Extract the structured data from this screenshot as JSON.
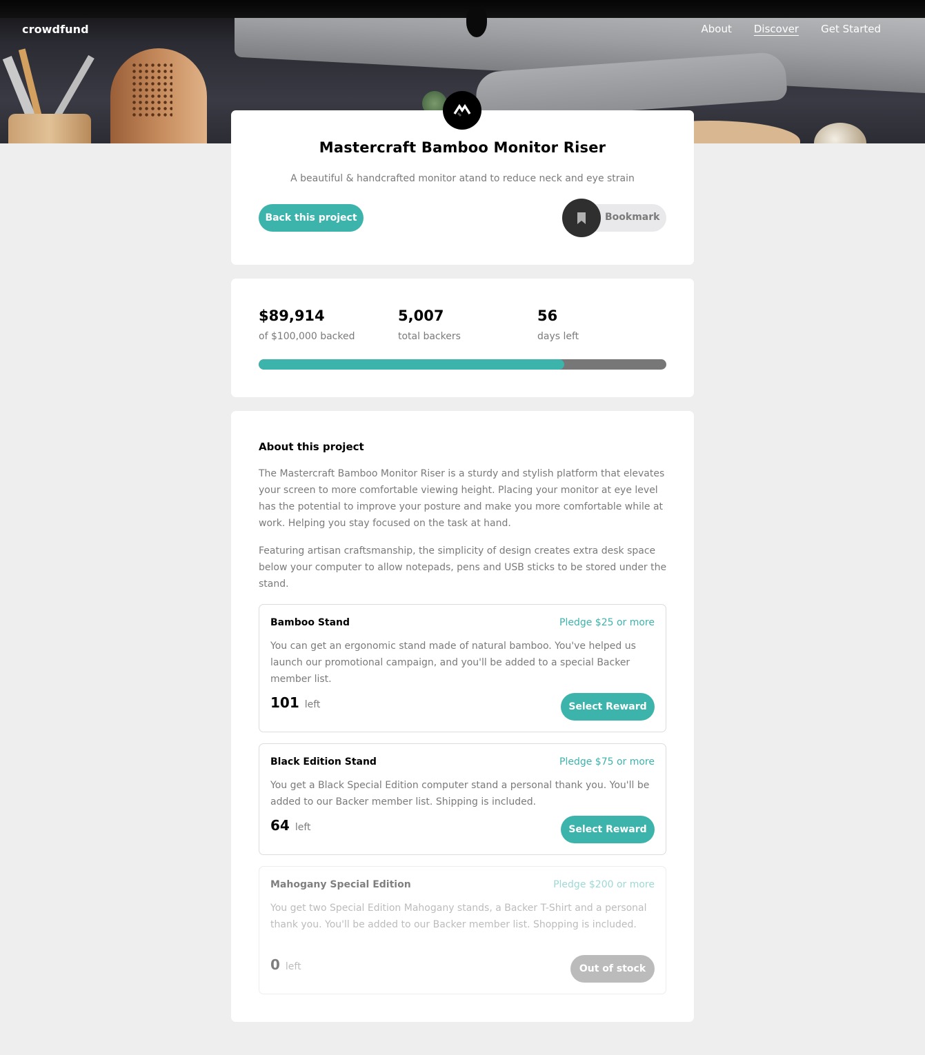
{
  "nav": {
    "logo": "crowdfund",
    "links": [
      "About",
      "Discover",
      "Get Started"
    ],
    "active": "Discover"
  },
  "project": {
    "title": "Mastercraft Bamboo Monitor Riser",
    "subtitle": "A beautiful & handcrafted monitor atand to reduce neck and eye strain",
    "back_button": "Back this project",
    "bookmark_label": "Bookmark"
  },
  "stats": {
    "backed_amount": "$89,914",
    "backed_label": "of $100,000 backed",
    "backers": "5,007",
    "backers_label": "total backers",
    "days": "56",
    "days_label": "days left",
    "progress_fraction": 0.75
  },
  "about": {
    "title": "About this project",
    "paragraph1": "The Mastercraft Bamboo Monitor Riser is a sturdy and stylish platform that elevates your screen to more comfortable viewing height. Placing your monitor at eye level has the potential to improve your posture and make you more comfortable while at work. Helping you stay focused on the task at hand.",
    "paragraph2": "Featuring artisan craftsmanship, the simplicity of design creates extra desk space below your computer to allow notepads, pens and USB sticks to be stored under the stand."
  },
  "rewards": [
    {
      "name": "Bamboo Stand",
      "pledge": "Pledge $25 or more",
      "description": "You can get an ergonomic stand made of natural bamboo. You've helped us launch our promotional campaign, and you'll be added to a special Backer member list.",
      "count": "101",
      "left_label": "left",
      "button": "Select Reward"
    },
    {
      "name": "Black Edition Stand",
      "pledge": "Pledge $75 or more",
      "description": "You get a Black Special Edition computer stand a personal thank you. You'll be added to our Backer member list. Shipping is included.",
      "count": "64",
      "left_label": "left",
      "button": "Select Reward"
    },
    {
      "name": "Mahogany Special Edition",
      "pledge": "Pledge $200 or more",
      "description": "You get two Special Edition Mahogany stands, a Backer T-Shirt and a personal thank you. You'll be added to our Backer member list. Shopping is included.",
      "count": "0",
      "left_label": "left",
      "button": "Out of stock"
    }
  ],
  "colors": {
    "accent": "#3cb3ab",
    "dark": "#2f2f2f",
    "background": "#eeeeee"
  }
}
